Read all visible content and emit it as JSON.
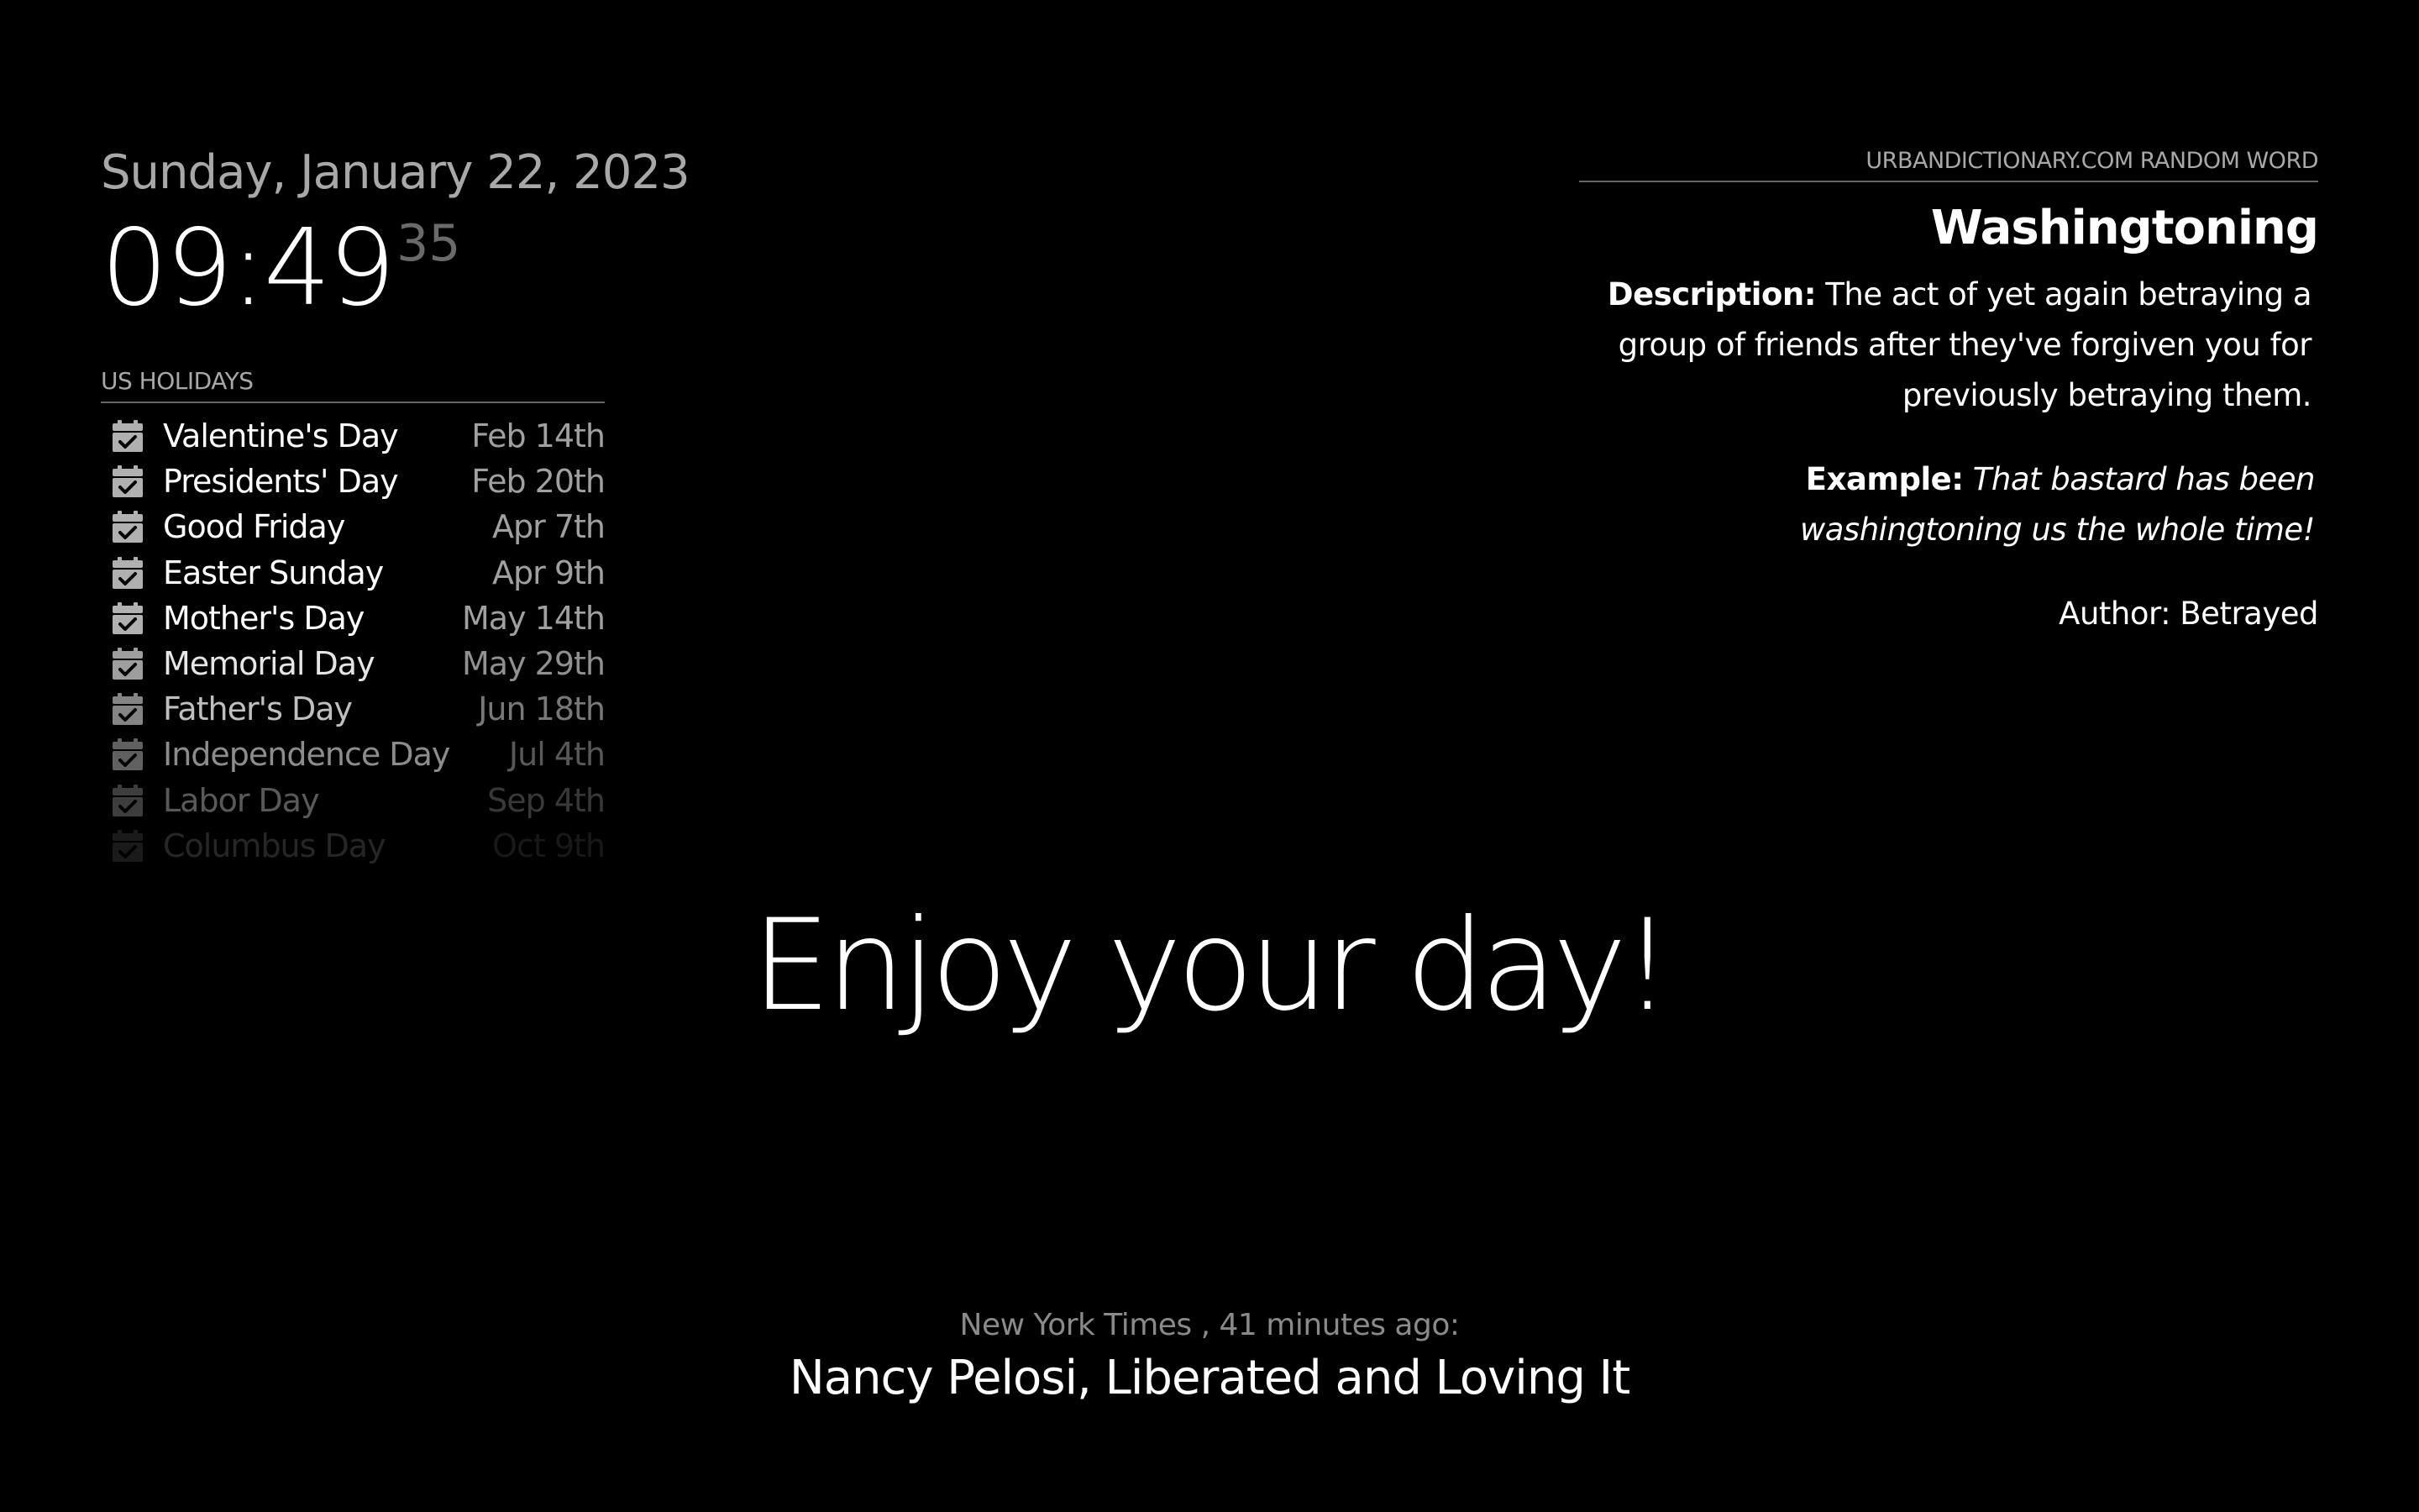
{
  "clock": {
    "date": "Sunday, January 22, 2023",
    "time_hm": "09:49",
    "time_seconds": "35"
  },
  "holidays": {
    "header": "US HOLIDAYS",
    "icon": "calendar-check-icon",
    "items": [
      {
        "name": "Valentine's Day",
        "date": "Feb 14th",
        "opacity": 1.0
      },
      {
        "name": "Presidents' Day",
        "date": "Feb 20th",
        "opacity": 1.0
      },
      {
        "name": "Good Friday",
        "date": "Apr 7th",
        "opacity": 1.0
      },
      {
        "name": "Easter Sunday",
        "date": "Apr 9th",
        "opacity": 1.0
      },
      {
        "name": "Mother's Day",
        "date": "May 14th",
        "opacity": 1.0
      },
      {
        "name": "Memorial Day",
        "date": "May 29th",
        "opacity": 0.9
      },
      {
        "name": "Father's Day",
        "date": "Jun 18th",
        "opacity": 0.75
      },
      {
        "name": "Independence Day",
        "date": "Jul 4th",
        "opacity": 0.55
      },
      {
        "name": "Labor Day",
        "date": "Sep 4th",
        "opacity": 0.35
      },
      {
        "name": "Columbus Day",
        "date": "Oct 9th",
        "opacity": 0.15
      }
    ]
  },
  "urban_dictionary": {
    "header": "URBANDICTIONARY.COM RANDOM WORD",
    "word": "Washingtoning",
    "description_label": "Description:",
    "description": "The act of yet again betraying a group of friends after they've forgiven you for previously betraying them.",
    "example_label": "Example:",
    "example": "That bastard has been washingtoning us the whole time!",
    "author": "Author: Betrayed"
  },
  "compliment": {
    "text": "Enjoy your day!"
  },
  "news": {
    "source": "New York Times , 41 minutes ago:",
    "title": "Nancy Pelosi, Liberated and Loving It"
  }
}
